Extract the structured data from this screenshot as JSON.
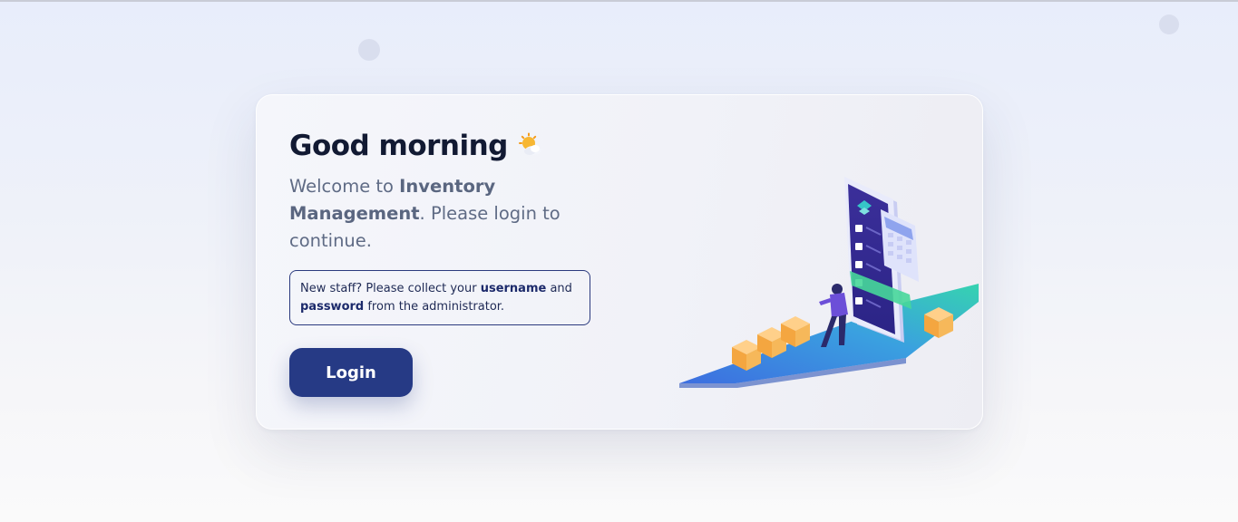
{
  "greeting": {
    "title": "Good morning",
    "icon": "sun-cloud-icon"
  },
  "welcome": {
    "prefix": "Welcome to ",
    "app_name": "Inventory Management",
    "suffix": ". Please login to continue."
  },
  "notice": {
    "part1": "New staff? Please collect your ",
    "username": "username",
    "part2": " and ",
    "password": "password",
    "part3": " from the administrator."
  },
  "login": {
    "label": "Login"
  },
  "colors": {
    "primary": "#263a85",
    "heading": "#121a33",
    "muted": "#5f6b85"
  },
  "illustration": {
    "icon": "inventory-phone-illustration"
  }
}
